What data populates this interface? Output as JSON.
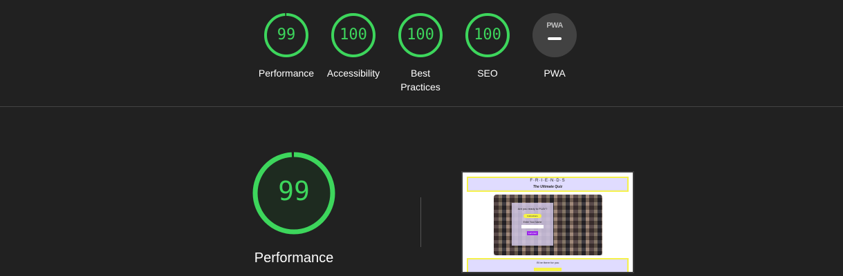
{
  "categories": [
    {
      "label": "Performance",
      "score": "99",
      "fraction": 0.99
    },
    {
      "label": "Accessibility",
      "score": "100",
      "fraction": 1.0
    },
    {
      "label": "Best Practices",
      "score": "100",
      "fraction": 1.0
    },
    {
      "label": "SEO",
      "score": "100",
      "fraction": 1.0
    }
  ],
  "pwa": {
    "label": "PWA",
    "badge_text": "PWA"
  },
  "detail": {
    "score": "99",
    "label": "Performance",
    "fraction": 0.99
  },
  "screenshot": {
    "title": "F·R·I·E·N·D·S",
    "subtitle": "The Ultimate Quiz",
    "question": "Are you ready to PLAY?",
    "instructions_button": "Instructions",
    "name_prompt": "Enter Your Name",
    "start_button": "Let's Go!",
    "footer_text": "I'll be there for you"
  },
  "colors": {
    "pass": "#3dd65c",
    "background": "#212121",
    "pwa_badge": "#424242"
  }
}
